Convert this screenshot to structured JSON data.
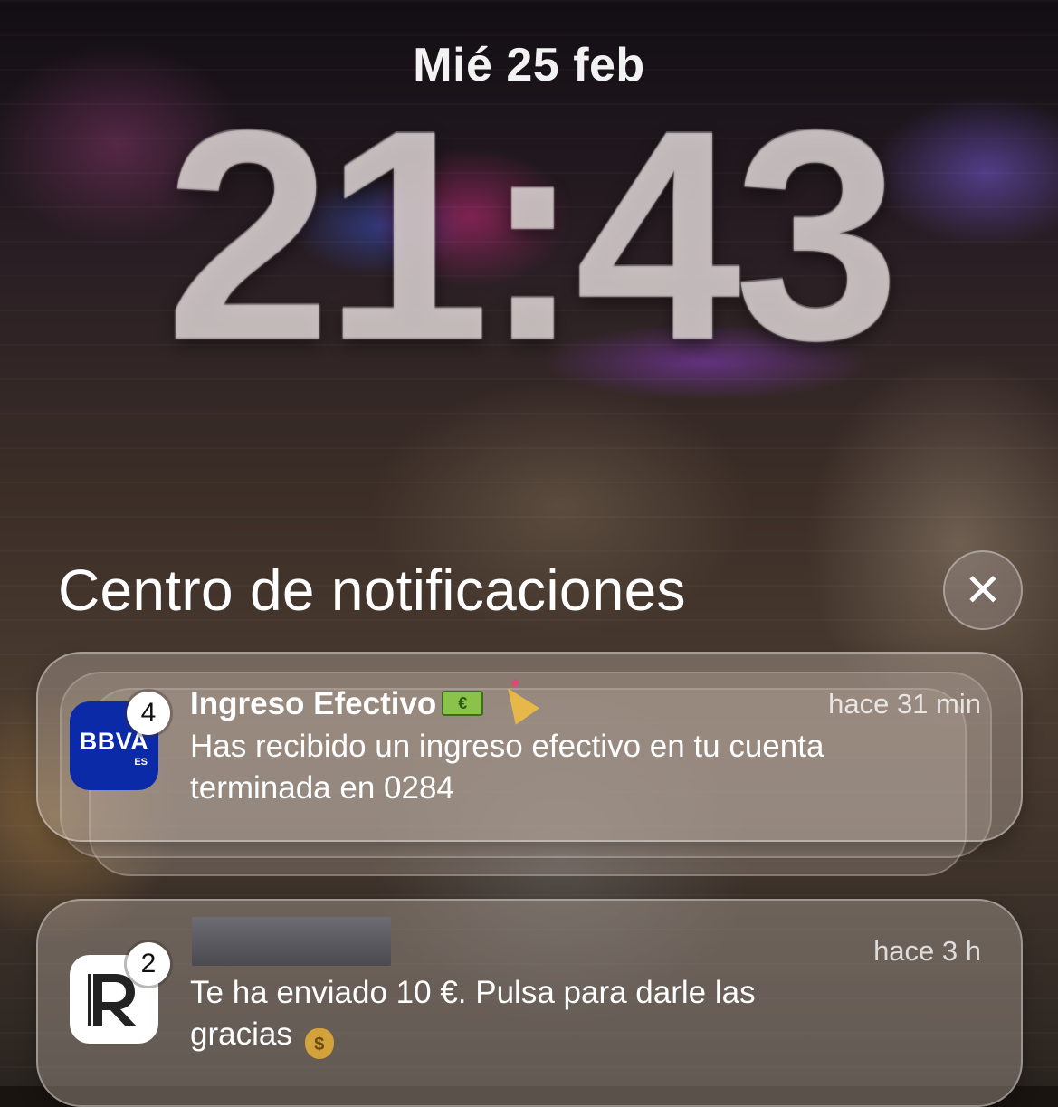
{
  "lockscreen": {
    "date": "Mié 25 feb",
    "time": "21:43"
  },
  "notification_center": {
    "title": "Centro de notificaciones",
    "close_icon": "close-icon"
  },
  "notifications": [
    {
      "app": "BBVA",
      "app_icon_text": "BBVA",
      "app_icon_subtext": "ES",
      "icon_color": "#0a2aa8",
      "badge_count": "4",
      "title": "Ingreso Efectivo",
      "title_emojis": [
        "money-emoji",
        "party-popper-emoji"
      ],
      "time": "hace 31 min",
      "body": "Has recibido un ingreso efectivo en tu cuenta terminada en 0284",
      "stacked": true
    },
    {
      "app": "Revolut",
      "app_icon_text": "R",
      "icon_color": "#ffffff",
      "badge_count": "2",
      "title_redacted": true,
      "time": "hace 3 h",
      "body": "Te ha enviado 10 €. Pulsa para darle las gracias",
      "body_emoji": "money-bag-emoji"
    }
  ]
}
